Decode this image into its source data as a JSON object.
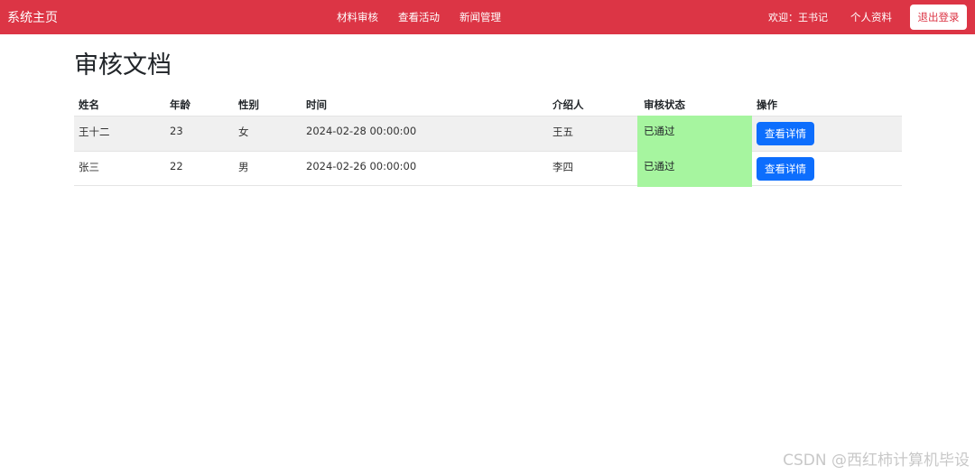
{
  "navbar": {
    "brand": "系统主页",
    "links": [
      "材料审核",
      "查看活动",
      "新闻管理"
    ],
    "welcome": "欢迎：王书记",
    "profile": "个人资料",
    "logout": "退出登录"
  },
  "page": {
    "title": "审核文档"
  },
  "table": {
    "headers": [
      "姓名",
      "年龄",
      "性别",
      "时间",
      "介绍人",
      "审核状态",
      "操作"
    ],
    "rows": [
      {
        "name": "王十二",
        "age": "23",
        "gender": "女",
        "time": "2024-02-28 00:00:00",
        "referrer": "王五",
        "status": "已通过",
        "action": "查看详情"
      },
      {
        "name": "张三",
        "age": "22",
        "gender": "男",
        "time": "2024-02-26 00:00:00",
        "referrer": "李四",
        "status": "已通过",
        "action": "查看详情"
      }
    ]
  },
  "watermark": "CSDN @西红柿计算机毕设",
  "colors": {
    "navbar": "#dc3545",
    "status_bg": "#a6f59f",
    "button": "#0d6efd"
  }
}
